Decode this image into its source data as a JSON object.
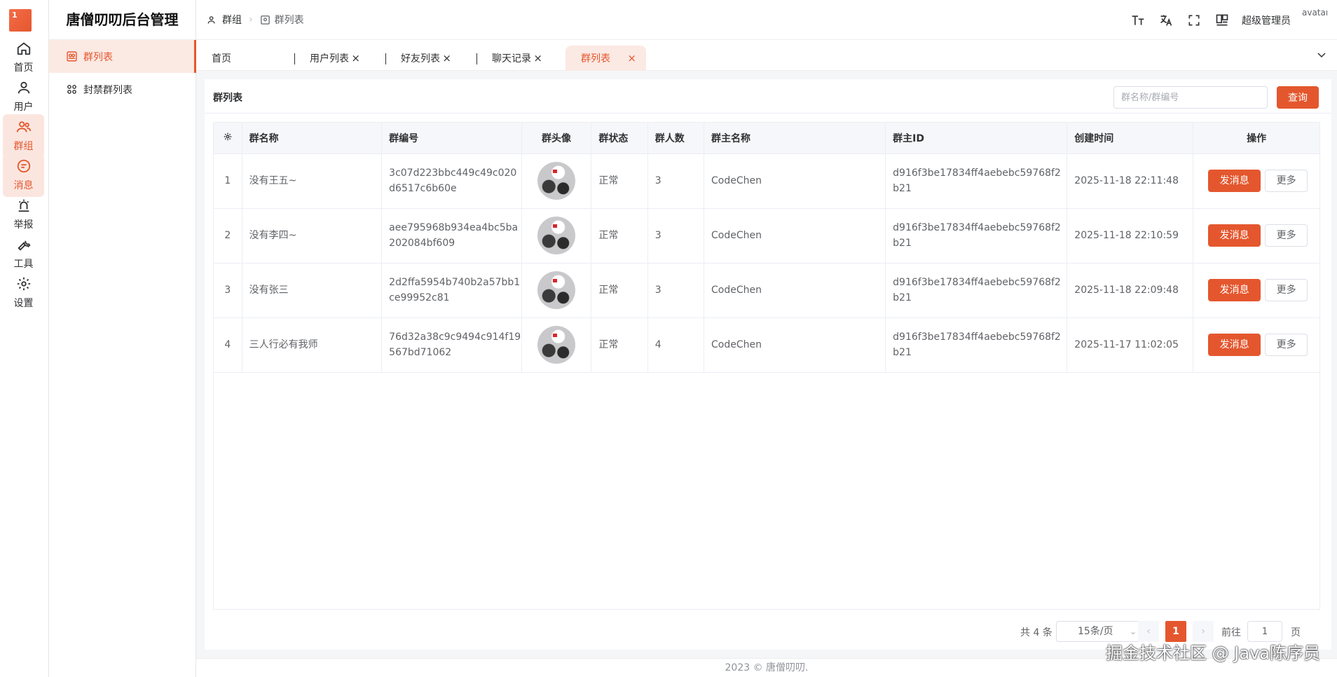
{
  "app": {
    "title": "唐僧叨叨后台管理",
    "logo_text": "1"
  },
  "rail": [
    {
      "label": "首页",
      "icon": "home-icon"
    },
    {
      "label": "用户",
      "icon": "user-icon"
    },
    {
      "label": "群组",
      "icon": "group-icon",
      "active": true
    },
    {
      "label": "消息",
      "icon": "message-icon",
      "active": true
    },
    {
      "label": "举报",
      "icon": "alarm-icon"
    },
    {
      "label": "工具",
      "icon": "wrench-icon"
    },
    {
      "label": "设置",
      "icon": "gear-icon"
    }
  ],
  "submenu": [
    {
      "label": "群列表",
      "active": true
    },
    {
      "label": "封禁群列表"
    }
  ],
  "breadcrumb": {
    "parent": "群组",
    "current": "群列表"
  },
  "header": {
    "username": "超级管理员",
    "avatar_alt": "avatar"
  },
  "tabs": [
    {
      "label": "首页"
    },
    {
      "label": "用户列表",
      "close": "×"
    },
    {
      "label": "好友列表",
      "close": "×"
    },
    {
      "label": "聊天记录",
      "close": "×"
    },
    {
      "label": "群列表",
      "close": "×",
      "active": true
    }
  ],
  "card": {
    "title": "群列表",
    "search_placeholder": "群名称/群编号",
    "search_button": "查询"
  },
  "table": {
    "columns": [
      "群名称",
      "群编号",
      "群头像",
      "群状态",
      "群人数",
      "群主名称",
      "群主ID",
      "创建时间",
      "操作"
    ],
    "rows": [
      {
        "index": "1",
        "name": "没有王五~",
        "no": "3c07d223bbc449c49c020d6517c6b60e",
        "status": "正常",
        "count": "3",
        "owner": "CodeChen",
        "owner_id": "d916f3be17834ff4aebebc59768f2b21",
        "created": "2025-11-18 22:11:48"
      },
      {
        "index": "2",
        "name": "没有李四~",
        "no": "aee795968b934ea4bc5ba202084bf609",
        "status": "正常",
        "count": "3",
        "owner": "CodeChen",
        "owner_id": "d916f3be17834ff4aebebc59768f2b21",
        "created": "2025-11-18 22:10:59"
      },
      {
        "index": "3",
        "name": "没有张三",
        "no": "2d2ffa5954b740b2a57bb1ce99952c81",
        "status": "正常",
        "count": "3",
        "owner": "CodeChen",
        "owner_id": "d916f3be17834ff4aebebc59768f2b21",
        "created": "2025-11-18 22:09:48"
      },
      {
        "index": "4",
        "name": "三人行必有我师",
        "no": "76d32a38c9c9494c914f19567bd71062",
        "status": "正常",
        "count": "4",
        "owner": "CodeChen",
        "owner_id": "d916f3be17834ff4aebebc59768f2b21",
        "created": "2025-11-17 11:02:05"
      }
    ],
    "send_label": "发消息",
    "more_label": "更多"
  },
  "pagination": {
    "total": "共 4 条",
    "page_size": "15条/页",
    "current": "1",
    "goto_label": "前往",
    "goto_value": "1",
    "page_label": "页"
  },
  "footer": "2023 © 唐僧叨叨.",
  "watermark": "掘金技术社区 @ Java陈序员",
  "colors": {
    "accent": "#e4572e",
    "accent_light": "#fbe9e3"
  }
}
